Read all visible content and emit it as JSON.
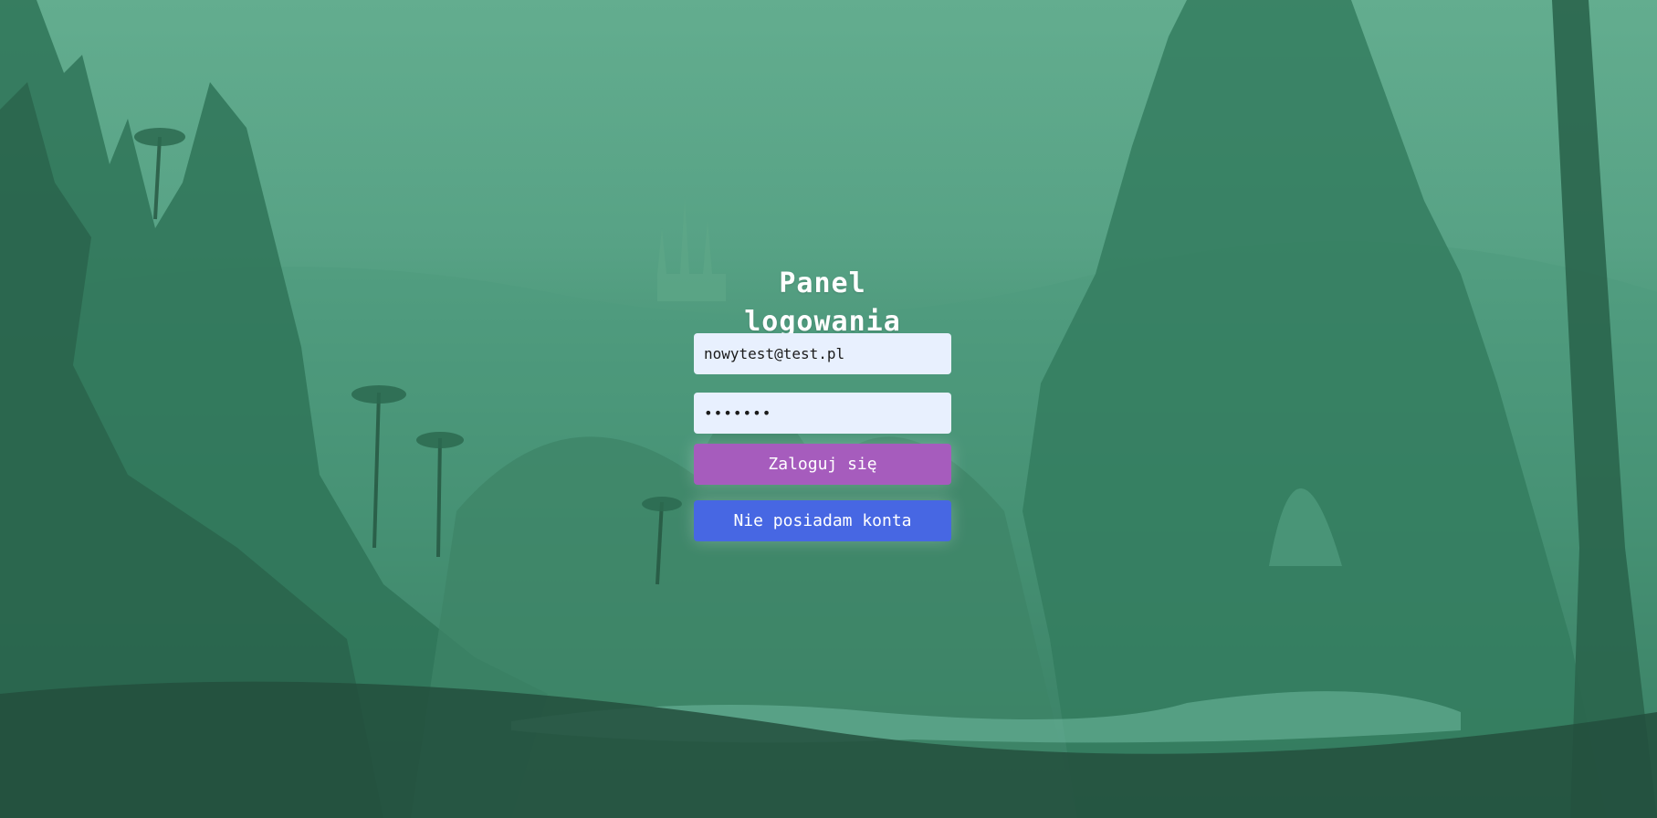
{
  "login_panel": {
    "title": "Panel logowania",
    "email_value": "nowytest@test.pl",
    "password_value": "•••••••",
    "login_label": "Zaloguj się",
    "register_label": "Nie posiadam konta"
  },
  "colors": {
    "login_button": "#a65cbd",
    "register_button": "#4767e3",
    "input_background": "#e8f0fe",
    "background_tint": "#57a285"
  }
}
